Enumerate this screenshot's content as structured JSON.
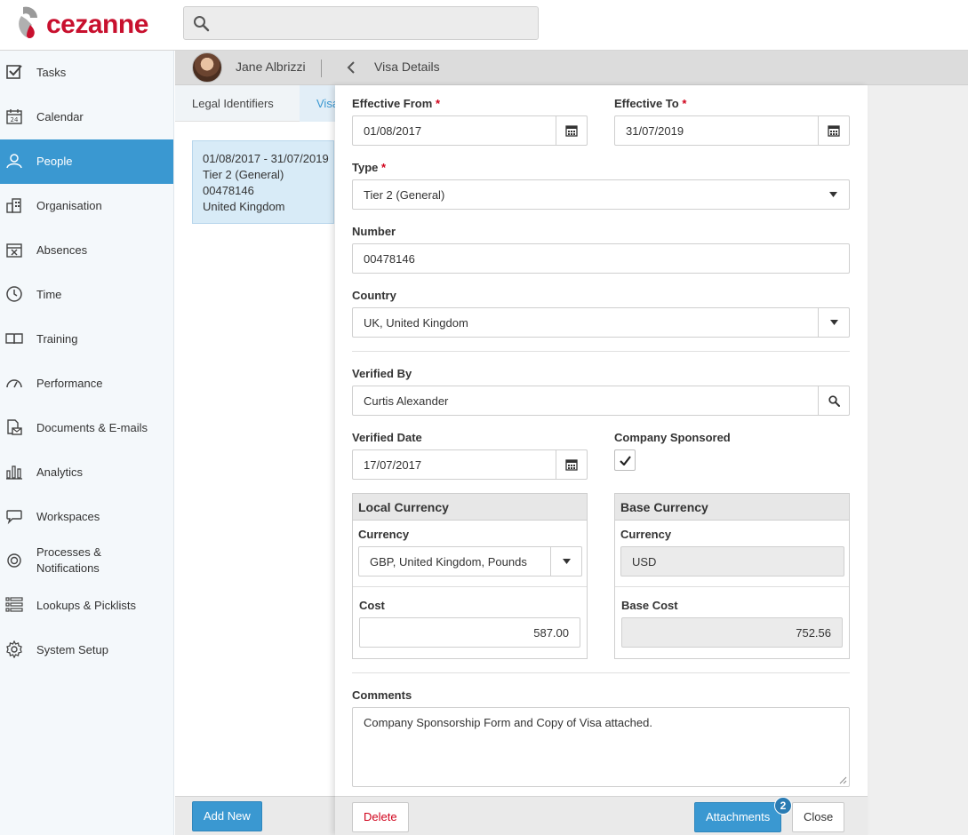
{
  "app": {
    "logo_text": "cezanne",
    "search_placeholder": ""
  },
  "sidebar": {
    "items": [
      {
        "label": "Tasks"
      },
      {
        "label": "Calendar"
      },
      {
        "label": "People"
      },
      {
        "label": "Organisation"
      },
      {
        "label": "Absences"
      },
      {
        "label": "Time"
      },
      {
        "label": "Training"
      },
      {
        "label": "Performance"
      },
      {
        "label": "Documents & E-mails"
      },
      {
        "label": "Analytics"
      },
      {
        "label": "Workspaces"
      },
      {
        "label": "Processes &",
        "label2": "Notifications"
      },
      {
        "label": "Lookups & Picklists"
      },
      {
        "label": "System Setup"
      }
    ],
    "active_index": 2
  },
  "header": {
    "user_name": "Jane Albrizzi",
    "breadcrumb": "Visa Details"
  },
  "tabs": {
    "legal": "Legal Identifiers",
    "visa": "Visa"
  },
  "list": {
    "line1": "01/08/2017 - 31/07/2019",
    "line2": "Tier 2 (General)",
    "line3": "00478146",
    "line4": "United Kingdom"
  },
  "left_footer": {
    "add_new": "Add New"
  },
  "form": {
    "effective_from": {
      "label": "Effective From",
      "value": "01/08/2017"
    },
    "effective_to": {
      "label": "Effective To",
      "value": "31/07/2019"
    },
    "type": {
      "label": "Type",
      "value": "Tier 2 (General)"
    },
    "number": {
      "label": "Number",
      "value": "00478146"
    },
    "country": {
      "label": "Country",
      "value": "UK, United Kingdom"
    },
    "verified_by": {
      "label": "Verified By",
      "value": "Curtis Alexander"
    },
    "verified_date": {
      "label": "Verified Date",
      "value": "17/07/2017"
    },
    "company_sponsored": {
      "label": "Company Sponsored",
      "checked": true
    },
    "required_mark": "*",
    "local": {
      "title": "Local Currency",
      "currency_label": "Currency",
      "currency_value": "GBP, United Kingdom, Pounds",
      "cost_label": "Cost",
      "cost_value": "587.00"
    },
    "base": {
      "title": "Base Currency",
      "currency_label": "Currency",
      "currency_value": "USD",
      "cost_label": "Base Cost",
      "cost_value": "752.56"
    },
    "comments": {
      "label": "Comments",
      "value": "Company Sponsorship Form and Copy of Visa attached."
    }
  },
  "panel_footer": {
    "delete": "Delete",
    "attachments": "Attachments",
    "attachments_count": "2",
    "close": "Close"
  },
  "colors": {
    "accent": "#3a98d1",
    "brand": "#c8102e",
    "required": "#d0021b"
  }
}
